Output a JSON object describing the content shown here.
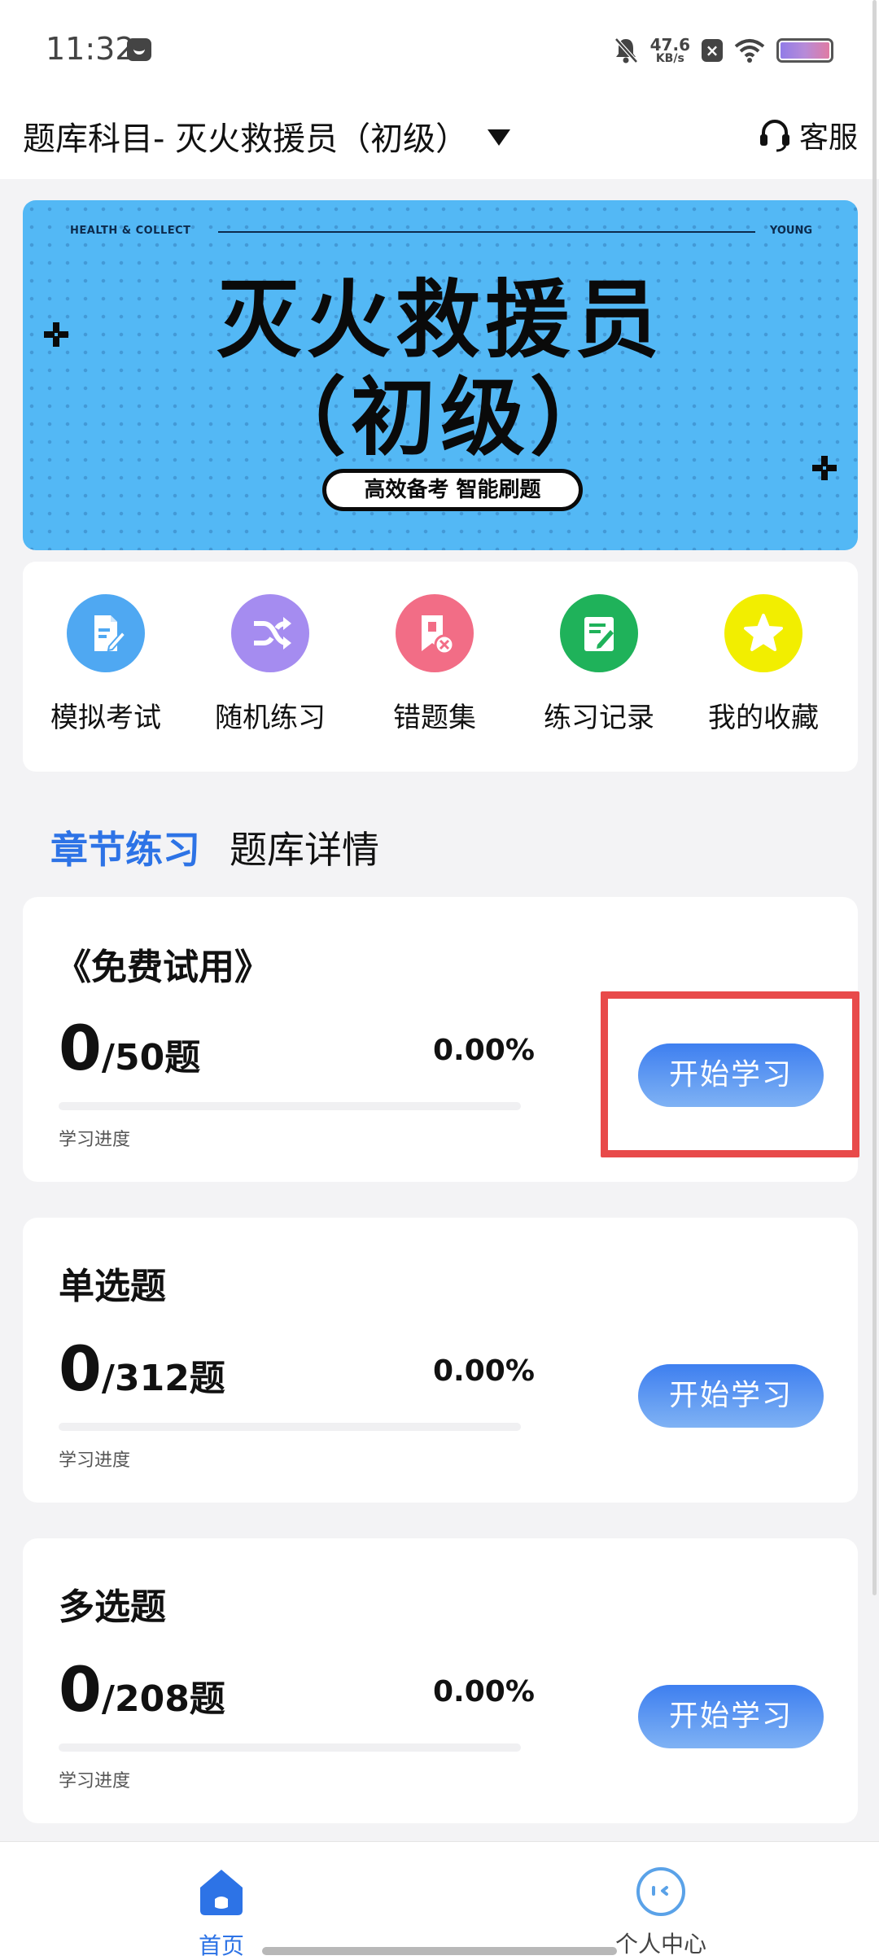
{
  "status_bar": {
    "time": "11:32",
    "net_speed_value": "47.6",
    "net_speed_unit": "KB/s",
    "icons": [
      "message-icon",
      "bell-off-icon",
      "close-box-icon",
      "wifi-icon",
      "battery-icon"
    ]
  },
  "header": {
    "subject_title": "题库科目- 灭火救援员（初级）",
    "service_label": "客服"
  },
  "banner": {
    "top_left": "HEALTH & COLLECT",
    "top_right": "YOUNG",
    "title_line1": "灭火救援员",
    "title_line2": "（初级）",
    "tagline": "高效备考 智能刷题",
    "colors": {
      "background": "#53b8f5"
    }
  },
  "quick_menu": [
    {
      "label": "模拟考试",
      "icon": "document-edit-icon",
      "color": "#4fa8f2"
    },
    {
      "label": "随机练习",
      "icon": "shuffle-icon",
      "color": "#a58cf0"
    },
    {
      "label": "错题集",
      "icon": "bookmark-error-icon",
      "color": "#f26d86"
    },
    {
      "label": "练习记录",
      "icon": "note-edit-icon",
      "color": "#1fb25a"
    },
    {
      "label": "我的收藏",
      "icon": "star-icon",
      "color": "#f2ee00"
    }
  ],
  "tabs": [
    {
      "label": "章节练习",
      "active": true
    },
    {
      "label": "题库详情",
      "active": false
    }
  ],
  "chapters": [
    {
      "title": "《免费试用》",
      "done": "0",
      "total_text": "/50题",
      "percent": "0.00%",
      "progress": 0,
      "progress_label": "学习进度",
      "button": "开始学习"
    },
    {
      "title": "单选题",
      "done": "0",
      "total_text": "/312题",
      "percent": "0.00%",
      "progress": 0,
      "progress_label": "学习进度",
      "button": "开始学习"
    },
    {
      "title": "多选题",
      "done": "0",
      "total_text": "/208题",
      "percent": "0.00%",
      "progress": 0,
      "progress_label": "学习进度",
      "button": "开始学习"
    }
  ],
  "bottom_nav": [
    {
      "label": "首页",
      "active": true,
      "color": "#2d73e6"
    },
    {
      "label": "个人中心",
      "active": false,
      "color": "#444444"
    }
  ],
  "accent_color": "#2d73e6",
  "highlight_color": "#e84a4a"
}
